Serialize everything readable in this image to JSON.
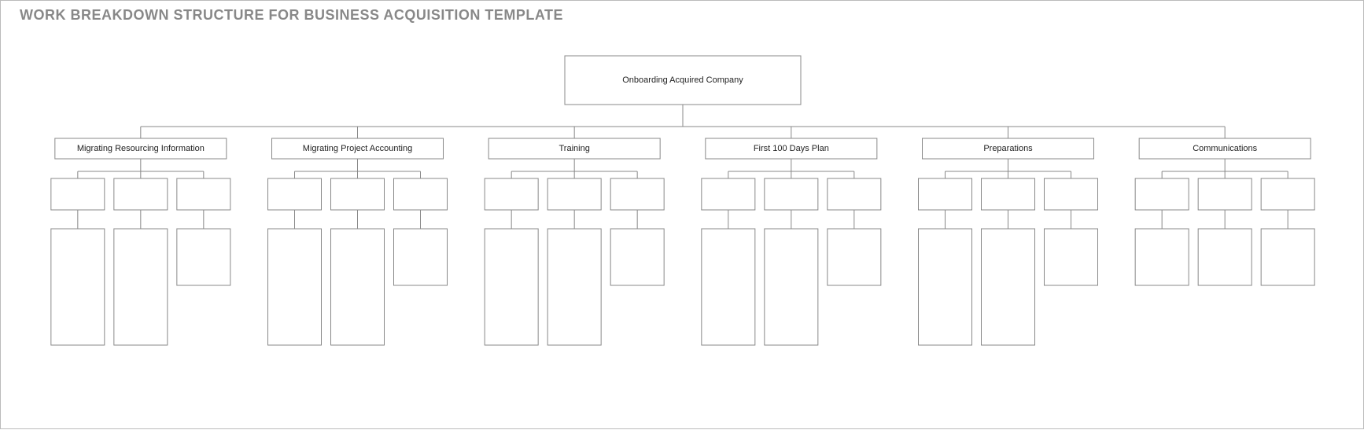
{
  "title": "WORK BREAKDOWN STRUCTURE FOR BUSINESS ACQUISITION TEMPLATE",
  "wbs": {
    "root": {
      "label": "Onboarding Acquired Company"
    },
    "branches": [
      {
        "label": "Migrating Resourcing Information",
        "children": [
          {
            "sub_label": "",
            "detail_label": "",
            "detail_height": 148
          },
          {
            "sub_label": "",
            "detail_label": "",
            "detail_height": 148
          },
          {
            "sub_label": "",
            "detail_label": "",
            "detail_height": 72
          }
        ]
      },
      {
        "label": "Migrating Project Accounting",
        "children": [
          {
            "sub_label": "",
            "detail_label": "",
            "detail_height": 148
          },
          {
            "sub_label": "",
            "detail_label": "",
            "detail_height": 148
          },
          {
            "sub_label": "",
            "detail_label": "",
            "detail_height": 72
          }
        ]
      },
      {
        "label": "Training",
        "children": [
          {
            "sub_label": "",
            "detail_label": "",
            "detail_height": 148
          },
          {
            "sub_label": "",
            "detail_label": "",
            "detail_height": 148
          },
          {
            "sub_label": "",
            "detail_label": "",
            "detail_height": 72
          }
        ]
      },
      {
        "label": "First 100 Days Plan",
        "children": [
          {
            "sub_label": "",
            "detail_label": "",
            "detail_height": 148
          },
          {
            "sub_label": "",
            "detail_label": "",
            "detail_height": 148
          },
          {
            "sub_label": "",
            "detail_label": "",
            "detail_height": 72
          }
        ]
      },
      {
        "label": "Preparations",
        "children": [
          {
            "sub_label": "",
            "detail_label": "",
            "detail_height": 148
          },
          {
            "sub_label": "",
            "detail_label": "",
            "detail_height": 148
          },
          {
            "sub_label": "",
            "detail_label": "",
            "detail_height": 72
          }
        ]
      },
      {
        "label": "Communications",
        "children": [
          {
            "sub_label": "",
            "detail_label": "",
            "detail_height": 72
          },
          {
            "sub_label": "",
            "detail_label": "",
            "detail_height": 72
          },
          {
            "sub_label": "",
            "detail_label": "",
            "detail_height": 72
          }
        ]
      }
    ]
  }
}
